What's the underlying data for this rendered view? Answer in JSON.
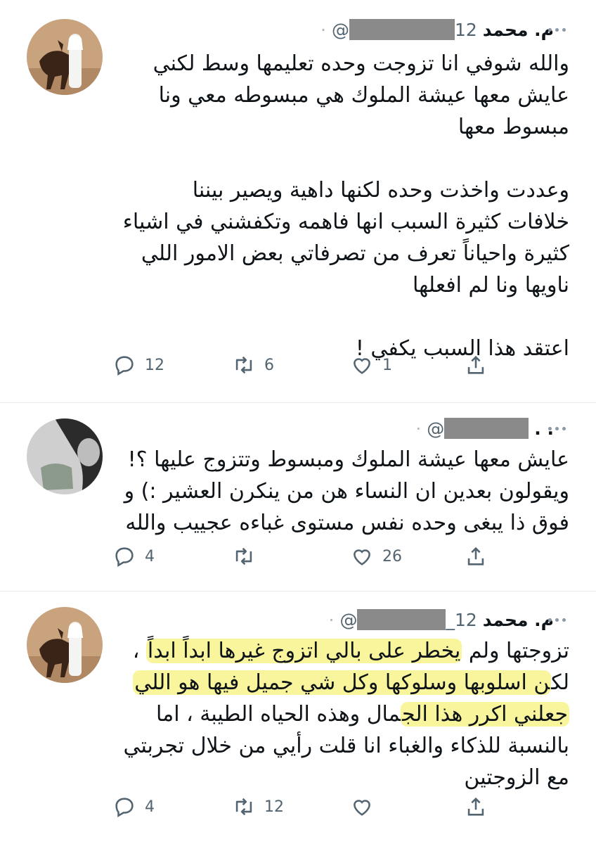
{
  "tweets": [
    {
      "name": "م. محمد",
      "handle_prefix": "@",
      "handle_suffix": "12",
      "text": [
        "والله شوفي انا تزوجت وحده تعليمها وسط لكني",
        "عايش معها عيشة الملوك هي مبسوطه معي ونا",
        "مبسوط معها",
        "",
        "وعددت واخذت وحده لكنها داهية ويصير بيننا",
        "خلافات كثيرة السبب انها فاهمه وتكفشني في اشياء",
        "كثيرة واحياناً تعرف من تصرفاتي بعض الامور اللي",
        "ناويها ونا لم افعلها",
        "",
        "اعتقد هذا السبب يكفي !"
      ],
      "counts": {
        "reply": "12",
        "retweet": "6",
        "like": "1"
      }
    },
    {
      "name": ". .",
      "handle_prefix": "@",
      "handle_suffix": "",
      "text": [
        "عايش معها عيشة الملوك ومبسوط وتتزوج عليها ؟!",
        "ويقولون بعدين ان النساء هن من ينكرن العشير :) و",
        "فوق ذا يبغى وحده نفس مستوى غباءه عجييب والله"
      ],
      "counts": {
        "reply": "4",
        "retweet": "",
        "like": "26"
      }
    },
    {
      "name": "م. محمد",
      "handle_prefix": "@",
      "handle_suffix": "_12",
      "text_hl": [
        {
          "pre": "تزوجتها ولم ",
          "hl": "يخطر على بالي اتزوج غيرها ابداً ابداً",
          "post": " ،"
        },
        {
          "pre": "لك",
          "hl": "ن اسلوبها وسلوكها وكل شي جميل فيها هو اللي",
          "post": ""
        },
        {
          "pre": "",
          "hl": "جعلني اكرر هذا الج",
          "post": "مال وهذه الحياه الطيبة ، اما"
        },
        {
          "pre": "بالنسبة للذكاء والغباء انا قلت رأيي من خلال تجربتي",
          "hl": "",
          "post": ""
        },
        {
          "pre": "مع الزوجتين",
          "hl": "",
          "post": ""
        }
      ],
      "counts": {
        "reply": "4",
        "retweet": "12",
        "like": ""
      }
    }
  ],
  "icons": {
    "reply": "reply-icon",
    "retweet": "retweet-icon",
    "like": "like-icon",
    "share": "share-icon",
    "more": "more-icon"
  },
  "colors": {
    "icon": "#536471",
    "highlight": "#f7f38c",
    "redaction": "#8a8a8a"
  }
}
